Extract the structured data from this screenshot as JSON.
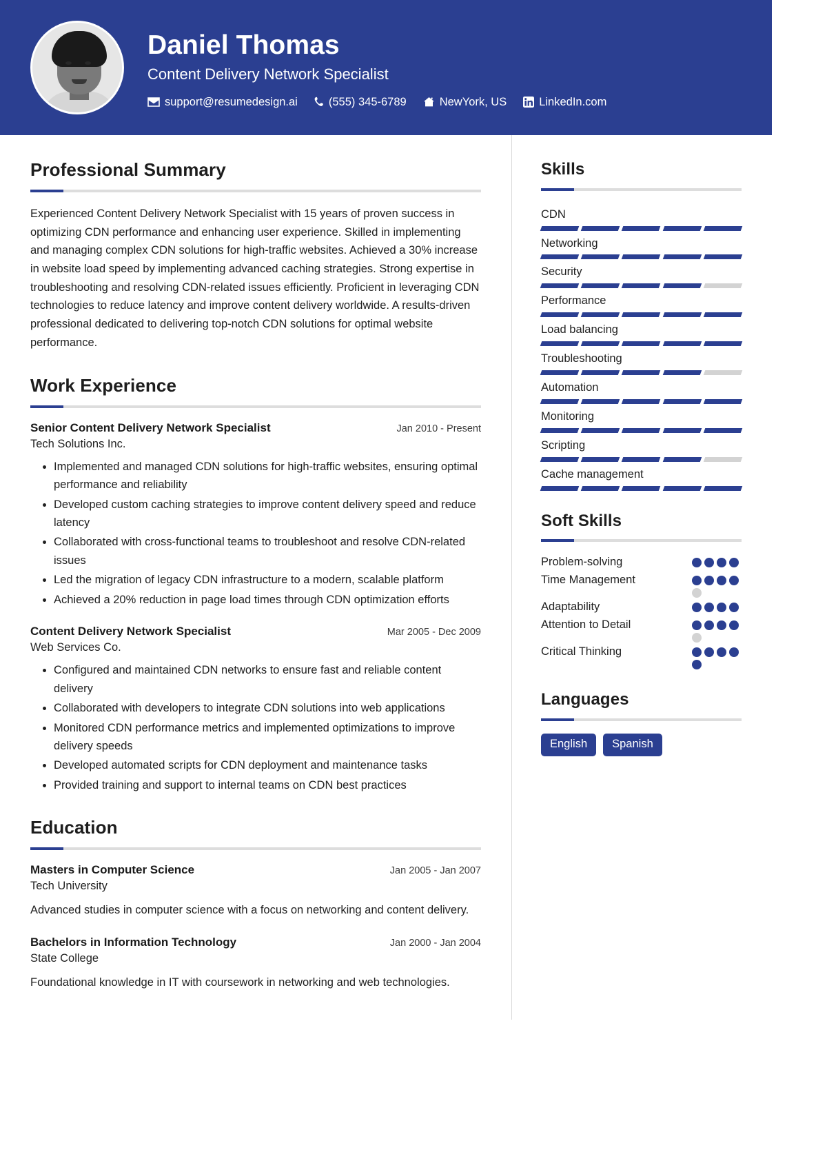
{
  "theme": {
    "primary": "#2b3f91",
    "track": "#d3d3d3",
    "rule": "#dddddd",
    "text": "#212121"
  },
  "header": {
    "name": "Daniel Thomas",
    "job_title": "Content Delivery Network Specialist",
    "contacts": [
      {
        "icon": "envelope-icon",
        "text": "support@resumedesign.ai"
      },
      {
        "icon": "phone-icon",
        "text": "(555) 345-6789"
      },
      {
        "icon": "home-icon",
        "text": "NewYork, US"
      },
      {
        "icon": "linkedin-icon",
        "text": "LinkedIn.com"
      }
    ]
  },
  "summary": {
    "title": "Professional Summary",
    "text": "Experienced Content Delivery Network Specialist with 15 years of proven success in optimizing CDN performance and enhancing user experience. Skilled in implementing and managing complex CDN solutions for high-traffic websites. Achieved a 30% increase in website load speed by implementing advanced caching strategies. Strong expertise in troubleshooting and resolving CDN-related issues efficiently. Proficient in leveraging CDN technologies to reduce latency and improve content delivery worldwide. A results-driven professional dedicated to delivering top-notch CDN solutions for optimal website performance."
  },
  "experience": {
    "title": "Work Experience",
    "entries": [
      {
        "role": "Senior Content Delivery Network Specialist",
        "org": "Tech Solutions Inc.",
        "date": "Jan 2010 - Present",
        "bullets": [
          "Implemented and managed CDN solutions for high-traffic websites, ensuring optimal performance and reliability",
          "Developed custom caching strategies to improve content delivery speed and reduce latency",
          "Collaborated with cross-functional teams to troubleshoot and resolve CDN-related issues",
          "Led the migration of legacy CDN infrastructure to a modern, scalable platform",
          "Achieved a 20% reduction in page load times through CDN optimization efforts"
        ]
      },
      {
        "role": "Content Delivery Network Specialist",
        "org": "Web Services Co.",
        "date": "Mar 2005 - Dec 2009",
        "bullets": [
          "Configured and maintained CDN networks to ensure fast and reliable content delivery",
          "Collaborated with developers to integrate CDN solutions into web applications",
          "Monitored CDN performance metrics and implemented optimizations to improve delivery speeds",
          "Developed automated scripts for CDN deployment and maintenance tasks",
          "Provided training and support to internal teams on CDN best practices"
        ]
      }
    ]
  },
  "education": {
    "title": "Education",
    "entries": [
      {
        "role": "Masters in Computer Science",
        "org": "Tech University",
        "date": "Jan 2005 - Jan 2007",
        "desc": "Advanced studies in computer science with a focus on networking and content delivery."
      },
      {
        "role": "Bachelors in Information Technology",
        "org": "State College",
        "date": "Jan 2000 - Jan 2004",
        "desc": "Foundational knowledge in IT with coursework in networking and web technologies."
      }
    ]
  },
  "skills": {
    "title": "Skills",
    "segments": 5,
    "items": [
      {
        "name": "CDN",
        "filled": 5
      },
      {
        "name": "Networking",
        "filled": 5
      },
      {
        "name": "Security",
        "filled": 4
      },
      {
        "name": "Performance",
        "filled": 5
      },
      {
        "name": "Load balancing",
        "filled": 5
      },
      {
        "name": "Troubleshooting",
        "filled": 4
      },
      {
        "name": "Automation",
        "filled": 5
      },
      {
        "name": "Monitoring",
        "filled": 5
      },
      {
        "name": "Scripting",
        "filled": 4
      },
      {
        "name": "Cache management",
        "filled": 5
      }
    ]
  },
  "soft_skills": {
    "title": "Soft Skills",
    "max_dots": 5,
    "items": [
      {
        "name": "Problem-solving",
        "filled": 4,
        "total": 4
      },
      {
        "name": "Time Management",
        "filled": 4,
        "total": 5
      },
      {
        "name": "Adaptability",
        "filled": 4,
        "total": 4
      },
      {
        "name": "Attention to Detail",
        "filled": 4,
        "total": 5
      },
      {
        "name": "Critical Thinking",
        "filled": 5,
        "total": 5
      }
    ]
  },
  "languages": {
    "title": "Languages",
    "items": [
      "English",
      "Spanish"
    ]
  }
}
